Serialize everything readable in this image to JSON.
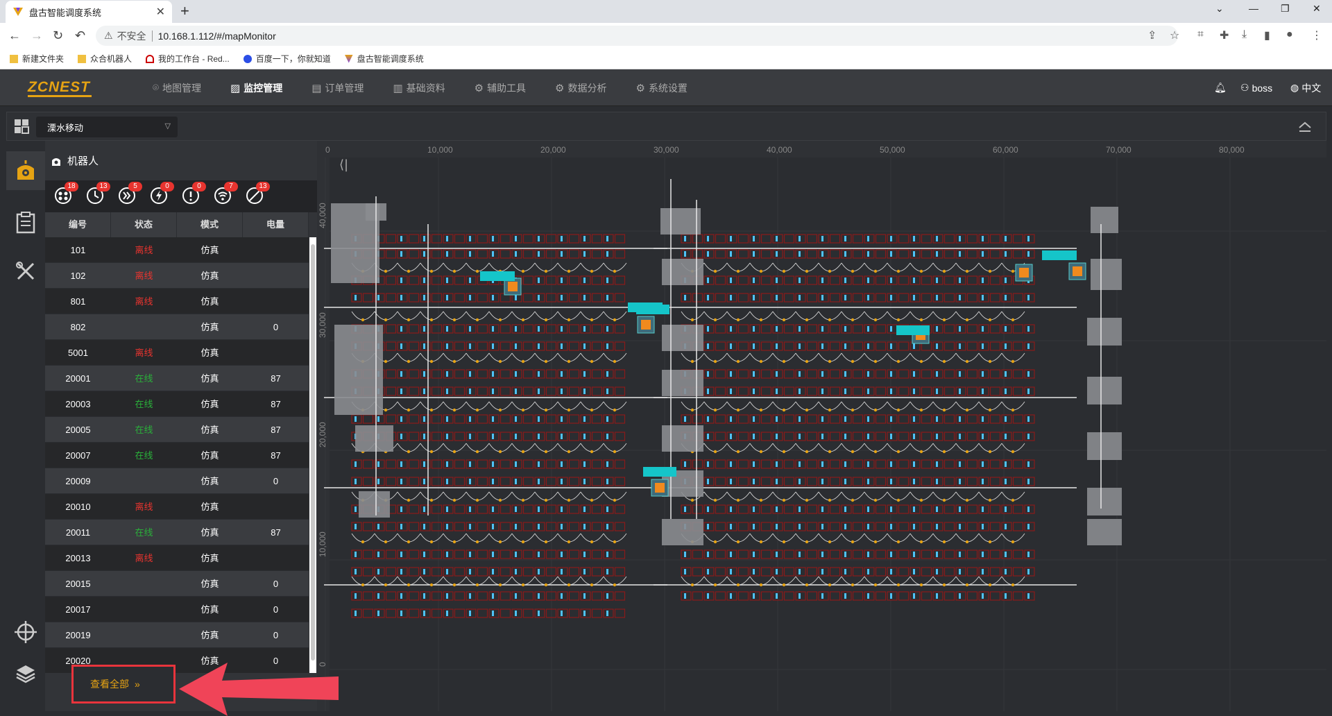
{
  "browser": {
    "tab_title": "盘古智能调度系统",
    "insecure_label": "不安全",
    "url": "10.168.1.112/#/mapMonitor",
    "bookmarks": [
      "新建文件夹",
      "众合机器人",
      "我的工作台 - Red...",
      "百度一下，你就知道",
      "盘古智能调度系统"
    ]
  },
  "header": {
    "logo": "ZCNEST",
    "nav": [
      {
        "label": "地图管理",
        "icon": "map-pin-icon"
      },
      {
        "label": "监控管理",
        "icon": "monitor-icon"
      },
      {
        "label": "订单管理",
        "icon": "order-icon"
      },
      {
        "label": "基础资料",
        "icon": "data-icon"
      },
      {
        "label": "辅助工具",
        "icon": "gear-icon"
      },
      {
        "label": "数据分析",
        "icon": "gear-icon"
      },
      {
        "label": "系统设置",
        "icon": "gear-icon"
      }
    ],
    "active_nav": "监控管理",
    "user": "boss",
    "language": "中文"
  },
  "toolbar": {
    "site": "溧水移动"
  },
  "panel": {
    "title": "机器人",
    "filters": [
      {
        "name": "all",
        "count": "18"
      },
      {
        "name": "clock",
        "count": "13"
      },
      {
        "name": "forward",
        "count": "5"
      },
      {
        "name": "charging",
        "count": "0"
      },
      {
        "name": "alert",
        "count": "0"
      },
      {
        "name": "wifi",
        "count": "7"
      },
      {
        "name": "offline",
        "count": "13"
      }
    ],
    "columns": [
      "编号",
      "状态",
      "模式",
      "电量"
    ],
    "rows": [
      {
        "id": "101",
        "status": "离线",
        "status_type": "off",
        "mode": "仿真",
        "battery": ""
      },
      {
        "id": "102",
        "status": "离线",
        "status_type": "off",
        "mode": "仿真",
        "battery": ""
      },
      {
        "id": "801",
        "status": "离线",
        "status_type": "off",
        "mode": "仿真",
        "battery": ""
      },
      {
        "id": "802",
        "status": "",
        "status_type": "",
        "mode": "仿真",
        "battery": "0"
      },
      {
        "id": "5001",
        "status": "离线",
        "status_type": "off",
        "mode": "仿真",
        "battery": ""
      },
      {
        "id": "20001",
        "status": "在线",
        "status_type": "on",
        "mode": "仿真",
        "battery": "87"
      },
      {
        "id": "20003",
        "status": "在线",
        "status_type": "on",
        "mode": "仿真",
        "battery": "87"
      },
      {
        "id": "20005",
        "status": "在线",
        "status_type": "on",
        "mode": "仿真",
        "battery": "87"
      },
      {
        "id": "20007",
        "status": "在线",
        "status_type": "on",
        "mode": "仿真",
        "battery": "87"
      },
      {
        "id": "20009",
        "status": "",
        "status_type": "",
        "mode": "仿真",
        "battery": "0"
      },
      {
        "id": "20010",
        "status": "离线",
        "status_type": "off",
        "mode": "仿真",
        "battery": ""
      },
      {
        "id": "20011",
        "status": "在线",
        "status_type": "on",
        "mode": "仿真",
        "battery": "87"
      },
      {
        "id": "20013",
        "status": "离线",
        "status_type": "off",
        "mode": "仿真",
        "battery": ""
      },
      {
        "id": "20015",
        "status": "",
        "status_type": "",
        "mode": "仿真",
        "battery": "0"
      },
      {
        "id": "20017",
        "status": "",
        "status_type": "",
        "mode": "仿真",
        "battery": "0"
      },
      {
        "id": "20019",
        "status": "",
        "status_type": "",
        "mode": "仿真",
        "battery": "0"
      },
      {
        "id": "20020",
        "status": "",
        "status_type": "",
        "mode": "仿真",
        "battery": "0"
      }
    ],
    "view_all": "查看全部",
    "view_all_chevron": "»"
  },
  "map": {
    "x_ticks": [
      "0",
      "10,000",
      "20,000",
      "30,000",
      "40,000",
      "50,000",
      "60,000",
      "70,000",
      "80,000"
    ],
    "y_ticks": [
      "40,000",
      "30,000",
      "20,000",
      "10,000",
      "0"
    ],
    "collapse_glyph": "⟨|"
  },
  "colors": {
    "accent": "#e6a313",
    "offline": "#e8342f",
    "online": "#2ab03a",
    "badge": "#e8342f",
    "rack": "#8b1a1a",
    "marker": "#4fc3f7"
  }
}
